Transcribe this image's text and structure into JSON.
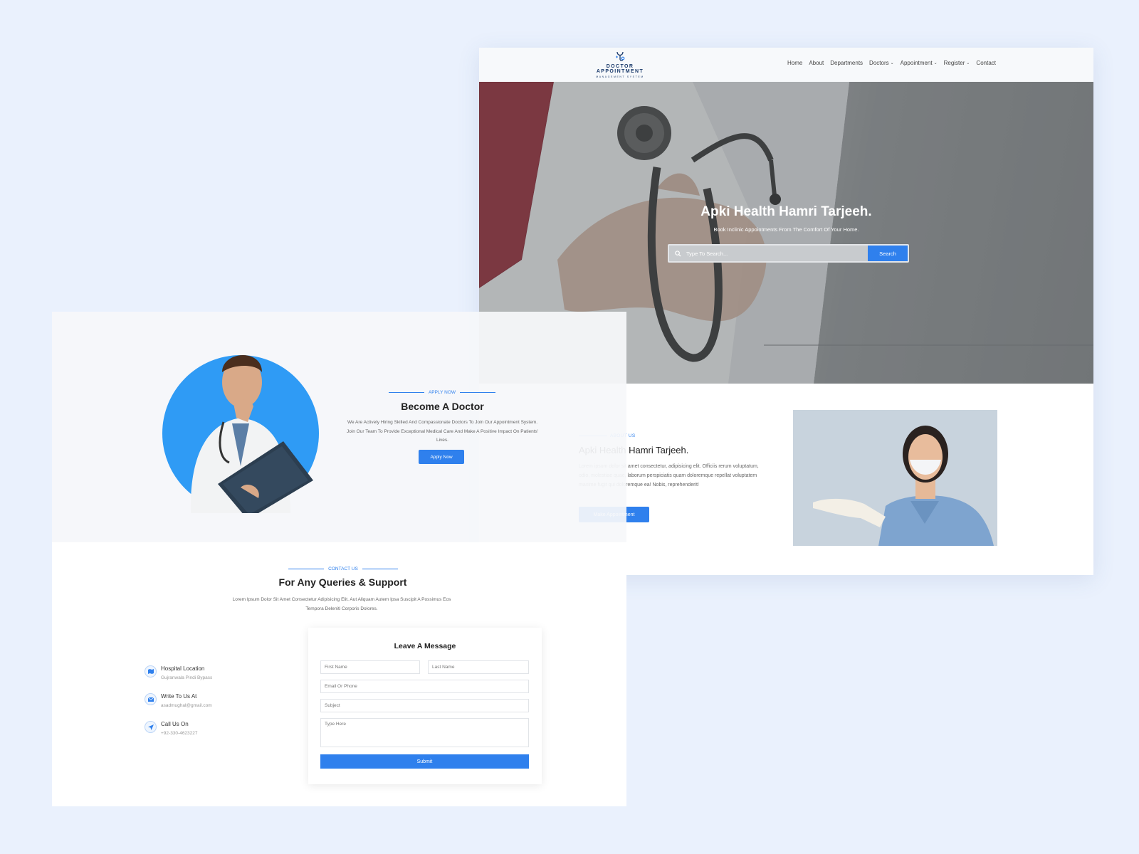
{
  "home": {
    "logo": {
      "title": "DOCTOR APPOINTMENT",
      "subtitle": "MANAGEMENT SYSTEM",
      "icon": "stethoscope-icon"
    },
    "nav": [
      {
        "label": "Home"
      },
      {
        "label": "About"
      },
      {
        "label": "Departments"
      },
      {
        "label": "Doctors",
        "dropdown": true
      },
      {
        "label": "Appointment",
        "dropdown": true
      },
      {
        "label": "Register",
        "dropdown": true
      },
      {
        "label": "Contact"
      }
    ],
    "hero": {
      "title": "Apki Health Hamri Tarjeeh.",
      "subtitle": "Book Inclinic Appointments From The Comfort Of Your Home.",
      "search_placeholder": "Type To Search...",
      "search_button": "Search"
    },
    "about": {
      "eyebrow": "ABOUT US",
      "title": "Apki Health Hamri Tarjeeh.",
      "text": "Lorem ipsum dolor sit amet consectetur, adipisicing elit. Officiis rerum voluptatum, odio, molestiae quae, laborum perspiciatis quam doloremque repellat voluptatem maxime fugit qui doloremque ea! Nobis, reprehenderit!",
      "button": "Make Appointment"
    }
  },
  "apply": {
    "eyebrow": "APPLY NOW",
    "title": "Become A Doctor",
    "text": "We Are Actively Hiring Skilled And Compassionate Doctors To Join Our Appointment System. Join Our Team To Provide Exceptional Medical Care And Make A Positive Impact On Patients' Lives.",
    "button": "Apply Now"
  },
  "contact": {
    "eyebrow": "CONTACT US",
    "title": "For Any Queries & Support",
    "text": "Lorem Ipsum Dolor Sit Amet Consectetur Adipisicing Elit. Aut Aliquam Autem Ipsa Suscipit A Possimus Eos Tempora Deleniti Corporis Dolores.",
    "info": [
      {
        "title": "Hospital Location",
        "value": "Gujranwala Pindi Bypass",
        "icon": "map-icon"
      },
      {
        "title": "Write To Us At",
        "value": "asadmughal@gmail.com",
        "icon": "envelope-icon"
      },
      {
        "title": "Call Us On",
        "value": "+92-330-4623227",
        "icon": "location-arrow-icon"
      }
    ],
    "form": {
      "title": "Leave A Message",
      "first_name": "First Name",
      "last_name": "Last Name",
      "email": "Email Or Phone",
      "subject": "Subject",
      "message": "Type Here",
      "submit": "Submit"
    }
  },
  "colors": {
    "accent": "#2f80ed",
    "background": "#eaf1fd",
    "heading": "#222222"
  }
}
